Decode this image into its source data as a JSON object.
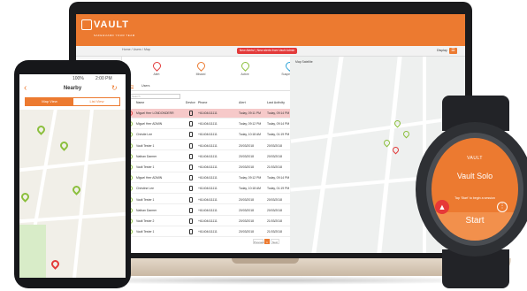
{
  "colors": {
    "brand": "#ec7a30",
    "alert": "#e33a3a",
    "active": "#8bbf3c",
    "help": "#2ea4d8",
    "offline": "#7a7a7a"
  },
  "laptop": {
    "logo_text": "VAULT",
    "logo_sub": "SAFEGUARD YOUR TEAM",
    "breadcrumbs": "Home / Users / Map",
    "alert_banner": "New Alerts! | New alerts from Vault Admin",
    "toggle_label": "Display",
    "toggle_icon": "☰",
    "sidebar": {
      "item_label": "Menu"
    },
    "stats": [
      {
        "label": "Alert",
        "color": "#e33a3a"
      },
      {
        "label": "Missed",
        "color": "#ec7a30"
      },
      {
        "label": "Active",
        "color": "#8bbf3c"
      },
      {
        "label": "Suspended",
        "color": "#2ea4d8"
      }
    ],
    "tabs": [
      "Alerts",
      "Users"
    ],
    "search_placeholder": "Search",
    "columns": [
      "Name",
      "Device",
      "Phone",
      "Alert",
      "Last Activity"
    ],
    "rows": [
      {
        "name": "Miguel Herr LONDONDERR",
        "phone": "+61404411111",
        "alert": "Today, 09:11 PM",
        "last": "Today, 09:14 PM",
        "status": "alert"
      },
      {
        "name": "Miguel Herr ADMIN",
        "phone": "+61404411111",
        "alert": "Today, 09:12 PM",
        "last": "Today, 09:14 PM",
        "status": "active"
      },
      {
        "name": "Christie Lee",
        "phone": "+61404411111",
        "alert": "Today, 10:18 AM",
        "last": "Today, 01:19 PM",
        "status": "active"
      },
      {
        "name": "Vault Tester 1",
        "phone": "+61404411111",
        "alert": "20/03/2018",
        "last": "20/03/2018",
        "status": "active"
      },
      {
        "name": "Nathan Darmer",
        "phone": "+61404411111",
        "alert": "20/03/2018",
        "last": "20/03/2018",
        "status": "active"
      },
      {
        "name": "Vault Tester 1",
        "phone": "+61404411111",
        "alert": "20/03/2018",
        "last": "21/03/2018",
        "status": "active"
      },
      {
        "name": "Miguel Herr ADMIN",
        "phone": "+61404411111",
        "alert": "Today, 09:12 PM",
        "last": "Today, 09:14 PM",
        "status": "active"
      },
      {
        "name": "Christine Lee",
        "phone": "+61404411111",
        "alert": "Today, 10:18 AM",
        "last": "Today, 01:19 PM",
        "status": "active"
      },
      {
        "name": "Vault Tester 1",
        "phone": "+61404411111",
        "alert": "20/03/2018",
        "last": "20/03/2018",
        "status": "active"
      },
      {
        "name": "Nathan Darmer",
        "phone": "+61404411111",
        "alert": "20/03/2018",
        "last": "20/03/2018",
        "status": "active"
      },
      {
        "name": "Vault Tester 2",
        "phone": "+61404411111",
        "alert": "20/03/2018",
        "last": "21/03/2018",
        "status": "active"
      },
      {
        "name": "Vault Tester 1",
        "phone": "+61404411111",
        "alert": "20/03/2018",
        "last": "21/03/2018",
        "status": "active"
      }
    ],
    "pager": {
      "prev": "Previous",
      "current": "1",
      "next": "Next"
    },
    "map_tabs": "Map   Satellite"
  },
  "phone": {
    "status_time": "2:00 PM",
    "status_battery": "100%",
    "title": "Nearby",
    "back_icon": "‹",
    "refresh_icon": "↻",
    "segments": [
      "Map View",
      "List View"
    ]
  },
  "watch": {
    "logo": "VAULT",
    "title": "Vault Solo",
    "hint": "Tap 'Start' to begin a session",
    "start_label": "Start",
    "alert_icon": "▲",
    "more_icon": "⋮"
  }
}
